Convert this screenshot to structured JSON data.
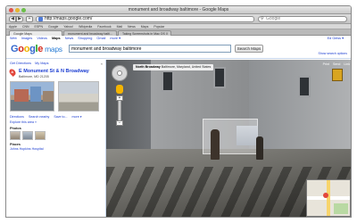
{
  "window": {
    "title": "monument and broadway baltimore - Google Maps"
  },
  "toolbar": {
    "back": "◀",
    "forward": "▶",
    "add": "+",
    "url": "http://maps.google.com/",
    "search_placeholder": "Google"
  },
  "bookmarks": [
    "Apple",
    "CNN",
    "ESPN",
    "Google",
    "Yahoo!",
    "Wikipedia",
    "Facebook",
    "Mail",
    "News",
    "Maps",
    "Popular"
  ],
  "tabs": [
    {
      "label": "Google Maps"
    },
    {
      "label": "monument and broadway balti..."
    },
    {
      "label": "Taking Screenshots in Mac OS X"
    }
  ],
  "gbar": {
    "items": [
      "Web",
      "Images",
      "Videos",
      "Maps",
      "News",
      "Shopping",
      "Gmail",
      "more ▾"
    ],
    "active_index": 3,
    "right": "Ed Geiss ▾"
  },
  "header": {
    "logo": {
      "g1": "G",
      "g2": "o",
      "g3": "o",
      "g4": "g",
      "g5": "l",
      "g6": "e",
      "maps": "maps"
    },
    "search_value": "monument and broadway baltimore",
    "search_button": "Search Maps",
    "links": "Show search options"
  },
  "left_panel": {
    "links": [
      "Get Directions",
      "My Maps"
    ],
    "collapse": "«",
    "marker": "A",
    "title": "E Monument St & N Broadway",
    "address": "Baltimore, MD 21205",
    "actions": [
      "Directions",
      "Search nearby",
      "Save to...",
      "more ▾"
    ],
    "explore": "Explore this area »",
    "photos_label": "Photos",
    "places_label": "Places",
    "place": "Johns Hopkins Hospital"
  },
  "street_view": {
    "address_bold": "North Broadway",
    "address_rest": "Baltimore, Maryland, United States",
    "controls": [
      "Print",
      "Send",
      "Link"
    ],
    "zoom_plus": "+",
    "zoom_minus": "−"
  }
}
